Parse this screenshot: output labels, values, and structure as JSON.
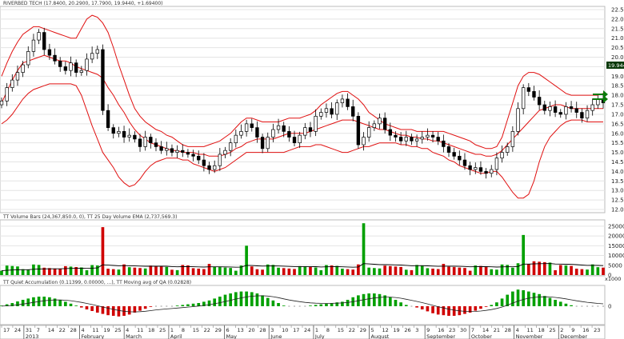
{
  "panels": {
    "price": {
      "title": "RIVERBED TECH (17.8400, 20.2900, 17.7900, 19.9440, +1.69400)",
      "last_price": "19.944",
      "axis_labels": [
        "22.5",
        "22.0",
        "21.5",
        "21.0",
        "20.5",
        "20.0",
        "19.5",
        "19.0",
        "18.5",
        "18.0",
        "17.5",
        "17.0",
        "16.5",
        "16.0",
        "15.5",
        "15.0",
        "14.5",
        "14.0",
        "13.5",
        "13.0",
        "12.5",
        "12.0"
      ]
    },
    "volume": {
      "title": "TT Volume Bars (24,367,850.0, 0), TT 25 Day Volume EMA (2,737,569.3)",
      "axis_labels": [
        "25000",
        "20000",
        "15000",
        "10000",
        "5000",
        "0"
      ],
      "unit_label": "x1000"
    },
    "qa": {
      "title": "TT Quiet Accumulation (0.11399, 0.00000, ...), TT Moving avg of QA (0.02828)",
      "axis_labels": [
        "0"
      ]
    }
  },
  "date_axis": {
    "days": [
      "17",
      "24",
      "31",
      "7",
      "14",
      "22",
      "28",
      "4",
      "11",
      "19",
      "25",
      "4",
      "11",
      "18",
      "25",
      "1",
      "8",
      "15",
      "22",
      "29",
      "6",
      "13",
      "20",
      "28",
      "3",
      "10",
      "17",
      "24",
      "1",
      "8",
      "15",
      "22",
      "29",
      "5",
      "12",
      "19",
      "26",
      "3",
      "9",
      "16",
      "23",
      "30",
      "7",
      "14",
      "21",
      "28",
      "4",
      "11",
      "18",
      "25",
      "2",
      "9",
      "16",
      "23"
    ],
    "months": [
      "2013",
      "February",
      "March",
      "April",
      "May",
      "June",
      "July",
      "August",
      "September",
      "October",
      "November",
      "December"
    ]
  },
  "colors": {
    "up": "#00a000",
    "down": "#d00000",
    "band": "#e01010",
    "ema": "#000000",
    "arrow": "#0a7a0a",
    "last_box": "#0a3a0a"
  },
  "chart_data": {
    "type": "candlestick-with-bollinger-bands",
    "title": "RIVERBED TECH",
    "ohlc_header": {
      "open": 17.84,
      "high": 20.29,
      "low": 17.79,
      "close": 19.944,
      "change": 1.694
    },
    "ylim": [
      12.0,
      22.5
    ],
    "close": [
      17.7,
      18.4,
      18.8,
      19.2,
      19.6,
      20.3,
      20.9,
      21.3,
      20.4,
      20.1,
      19.8,
      19.5,
      19.3,
      19.7,
      19.2,
      19.3,
      19.9,
      20.2,
      20.4,
      17.2,
      16.3,
      16.0,
      16.1,
      15.8,
      15.9,
      15.7,
      15.3,
      15.8,
      15.5,
      15.3,
      15.1,
      15.2,
      15.0,
      15.1,
      15.0,
      14.9,
      14.8,
      14.6,
      14.3,
      14.1,
      14.3,
      14.9,
      15.1,
      15.5,
      15.9,
      16.1,
      16.5,
      16.3,
      15.8,
      15.2,
      15.8,
      16.2,
      16.4,
      16.1,
      15.8,
      15.5,
      15.9,
      16.3,
      16.1,
      16.9,
      17.1,
      17.3,
      17.0,
      17.6,
      17.8,
      17.4,
      16.9,
      15.4,
      15.8,
      16.3,
      16.5,
      16.8,
      16.2,
      15.9,
      15.8,
      15.6,
      15.8,
      15.6,
      15.7,
      15.8,
      15.9,
      15.8,
      15.6,
      15.3,
      15.0,
      14.8,
      14.6,
      14.3,
      14.1,
      14.2,
      14.0,
      13.9,
      14.1,
      14.7,
      15.0,
      15.3,
      16.1,
      17.3,
      18.4,
      18.2,
      17.9,
      17.5,
      17.2,
      17.4,
      17.1,
      17.0,
      17.4,
      17.3,
      17.1,
      16.8,
      17.2,
      17.5,
      17.8,
      17.6
    ],
    "middle_band": [
      17.6,
      18.2,
      18.8,
      19.3,
      19.7,
      19.8,
      19.9,
      20.0,
      20.1,
      20.0,
      19.9,
      19.8,
      19.8,
      19.7,
      19.5,
      19.4,
      19.3,
      19.2,
      19.1,
      18.9,
      18.4,
      18.0,
      17.5,
      17.1,
      16.6,
      16.2,
      15.9,
      15.7,
      15.5,
      15.4,
      15.3,
      15.2,
      15.1,
      15.1,
      15.0,
      15.0,
      15.0,
      14.9,
      14.9,
      14.8,
      14.8,
      14.8,
      14.9,
      15.0,
      15.2,
      15.3,
      15.5,
      15.6,
      15.7,
      15.7,
      15.7,
      15.7,
      15.8,
      15.9,
      16.0,
      16.0,
      16.0,
      16.0,
      16.1,
      16.2,
      16.3,
      16.4,
      16.5,
      16.6,
      16.7,
      16.7,
      16.7,
      16.6,
      16.5,
      16.4,
      16.3,
      16.2,
      16.2,
      16.1,
      16.0,
      15.9,
      15.9,
      15.8,
      15.8,
      15.7,
      15.7,
      15.6,
      15.6,
      15.5,
      15.4,
      15.3,
      15.2,
      15.1,
      15.0,
      14.9,
      14.9,
      14.8,
      14.8,
      14.9,
      15.1,
      15.4,
      15.7,
      16.0,
      16.3,
      16.6,
      16.9,
      17.2,
      17.3,
      17.4,
      17.5,
      17.5,
      17.4,
      17.3,
      17.3,
      17.3,
      17.3,
      17.3,
      17.3,
      17.3
    ],
    "upper_band": [
      19.0,
      19.7,
      20.3,
      20.8,
      21.2,
      21.4,
      21.6,
      21.6,
      21.5,
      21.4,
      21.3,
      21.2,
      21.1,
      21.0,
      21.0,
      21.5,
      22.0,
      22.2,
      22.1,
      21.8,
      21.3,
      20.5,
      19.6,
      18.8,
      18.0,
      17.3,
      16.9,
      16.6,
      16.4,
      16.2,
      16.1,
      15.9,
      15.8,
      15.6,
      15.4,
      15.3,
      15.3,
      15.3,
      15.3,
      15.4,
      15.5,
      15.6,
      15.8,
      16.0,
      16.3,
      16.6,
      16.8,
      16.8,
      16.7,
      16.6,
      16.6,
      16.6,
      16.6,
      16.7,
      16.8,
      16.8,
      16.8,
      16.9,
      17.0,
      17.2,
      17.5,
      17.7,
      17.9,
      18.1,
      18.2,
      18.2,
      18.0,
      17.8,
      17.5,
      17.1,
      16.9,
      16.7,
      16.5,
      16.4,
      16.3,
      16.2,
      16.2,
      16.2,
      16.1,
      16.1,
      16.1,
      16.1,
      16.1,
      16.1,
      16.0,
      15.9,
      15.8,
      15.7,
      15.6,
      15.4,
      15.3,
      15.2,
      15.2,
      15.3,
      15.8,
      16.7,
      17.6,
      18.5,
      19.0,
      19.2,
      19.2,
      19.1,
      18.9,
      18.7,
      18.5,
      18.3,
      18.1,
      18.0,
      18.0,
      18.0,
      18.0,
      18.0,
      18.0,
      18.1
    ],
    "lower_band": [
      16.5,
      16.7,
      17.0,
      17.4,
      17.8,
      18.1,
      18.3,
      18.4,
      18.5,
      18.6,
      18.6,
      18.6,
      18.6,
      18.6,
      18.5,
      18.0,
      17.2,
      16.4,
      15.7,
      15.0,
      14.6,
      14.2,
      13.7,
      13.4,
      13.2,
      13.3,
      13.6,
      14.0,
      14.3,
      14.5,
      14.6,
      14.7,
      14.7,
      14.7,
      14.6,
      14.6,
      14.4,
      14.3,
      14.2,
      14.1,
      14.0,
      14.1,
      14.2,
      14.4,
      14.6,
      14.8,
      15.0,
      15.0,
      15.0,
      15.0,
      15.0,
      15.0,
      15.0,
      15.0,
      15.1,
      15.2,
      15.3,
      15.3,
      15.3,
      15.4,
      15.4,
      15.3,
      15.2,
      15.1,
      15.0,
      15.0,
      15.1,
      15.2,
      15.3,
      15.3,
      15.4,
      15.5,
      15.5,
      15.5,
      15.5,
      15.4,
      15.4,
      15.3,
      15.3,
      15.2,
      15.2,
      15.0,
      14.9,
      14.8,
      14.6,
      14.5,
      14.3,
      14.2,
      14.1,
      14.0,
      13.9,
      13.9,
      14.0,
      14.0,
      13.7,
      13.3,
      12.9,
      12.6,
      12.6,
      12.8,
      13.5,
      14.5,
      15.3,
      15.8,
      16.1,
      16.4,
      16.6,
      16.7,
      16.7,
      16.7,
      16.6,
      16.6,
      16.6,
      16.6
    ],
    "volume": {
      "ylim": [
        0,
        27000
      ],
      "unit": "x1000",
      "spikes": [
        {
          "index": 19,
          "value": 24500
        },
        {
          "index": 46,
          "value": 15000
        },
        {
          "index": 68,
          "value": 26500
        },
        {
          "index": 98,
          "value": 20500
        }
      ],
      "ema_last": 2737.6
    },
    "qa": {
      "values": [
        0.02,
        0.06,
        0.1,
        0.15,
        0.2,
        0.24,
        0.28,
        0.3,
        0.3,
        0.28,
        0.24,
        0.2,
        0.14,
        0.08,
        0.02,
        -0.04,
        -0.1,
        -0.15,
        -0.2,
        -0.24,
        -0.28,
        -0.3,
        -0.32,
        -0.3,
        -0.26,
        -0.2,
        -0.14,
        -0.08,
        -0.02,
        0.0,
        0.0,
        0.0,
        0.0,
        0.02,
        0.04,
        0.06,
        0.08,
        0.1,
        0.14,
        0.18,
        0.24,
        0.3,
        0.36,
        0.4,
        0.44,
        0.46,
        0.46,
        0.44,
        0.4,
        0.34,
        0.26,
        0.18,
        0.1,
        0.02,
        0.0,
        0.0,
        0.0,
        0.0,
        0.02,
        0.04,
        0.06,
        0.08,
        0.1,
        0.12,
        0.14,
        0.2,
        0.28,
        0.34,
        0.38,
        0.4,
        0.4,
        0.38,
        0.34,
        0.28,
        0.2,
        0.12,
        0.04,
        0.0,
        -0.04,
        -0.1,
        -0.16,
        -0.22,
        -0.26,
        -0.28,
        -0.3,
        -0.3,
        -0.28,
        -0.24,
        -0.2,
        -0.14,
        -0.08,
        -0.02,
        0.04,
        0.12,
        0.24,
        0.36,
        0.46,
        0.52,
        0.5,
        0.46,
        0.42,
        0.38,
        0.32,
        0.26,
        0.2,
        0.14,
        0.08,
        0.03,
        0.0,
        0.0,
        0.0,
        0.0,
        0.0,
        0.0
      ],
      "moving_avg_last": 0.02828
    },
    "annotations": [
      "green arrow pointing at 18.0",
      "green arrow pointing at 16.6"
    ]
  }
}
